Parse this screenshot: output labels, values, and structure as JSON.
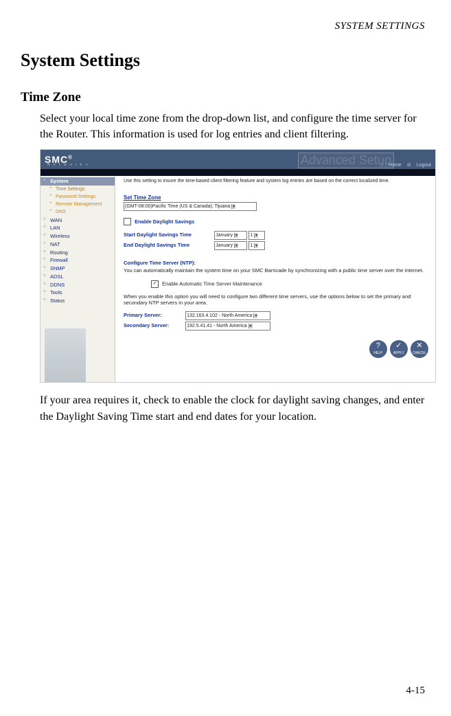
{
  "running_head": "SYSTEM SETTINGS",
  "h1": "System Settings",
  "h2": "Time Zone",
  "intro_para": "Select your local time zone from the drop-down list, and configure the time server for the Router. This information is used for log entries and client filtering.",
  "outro_para": "If your area requires it, check to enable the clock for daylight saving changes, and enter the Daylight Saving Time start and end dates for your location.",
  "page_number": "4-15",
  "shot": {
    "logo": "SMC",
    "logo_sub": "N e t w o r k s",
    "advanced": "Advanced Setup",
    "links": {
      "home": "Home",
      "logout": "Logout"
    },
    "sidebar": {
      "system": "System",
      "subs": [
        "Time Settings",
        "Password Settings",
        "Remote Management",
        "DNS"
      ],
      "items": [
        "WAN",
        "LAN",
        "Wireless",
        "NAT",
        "Routing",
        "Firewall",
        "SNMP",
        "ADSL",
        "DDNS",
        "Tools",
        "Status"
      ]
    },
    "content": {
      "intro": "Use this setting to insure the time-based client filtering feature and system log entries are based on the correct localized time.",
      "set_tz_title": "Set Time Zone",
      "tz_value": "(GMT-08:00)Pacific Time (US & Canada); Tijuana",
      "enable_ds": "Enable Daylight Savings",
      "start_ds": "Start Daylight Savings Time",
      "end_ds": "End Daylight Savings Time",
      "month": "January",
      "day": "1",
      "ntp_title": "Configure Time Server (NTP):",
      "ntp_desc": "You can automatically maintain the system time on your SMC Barricade by synchronizing with a public time server over the Internet.",
      "auto_maint": "Enable Automatic Time Server Maintenance",
      "ntp_desc2": "When you enable this option you will need to configure two different time servers, use the options below to set the primary and secondary NTP servers in your area.",
      "primary_lbl": "Primary Server:",
      "primary_val": "132.163.4.102 - North America",
      "secondary_lbl": "Secondary Server:",
      "secondary_val": "192.5.41.41 - North America",
      "btn_help": "HELP",
      "btn_apply": "APPLY",
      "btn_cancel": "CANCEL"
    }
  }
}
